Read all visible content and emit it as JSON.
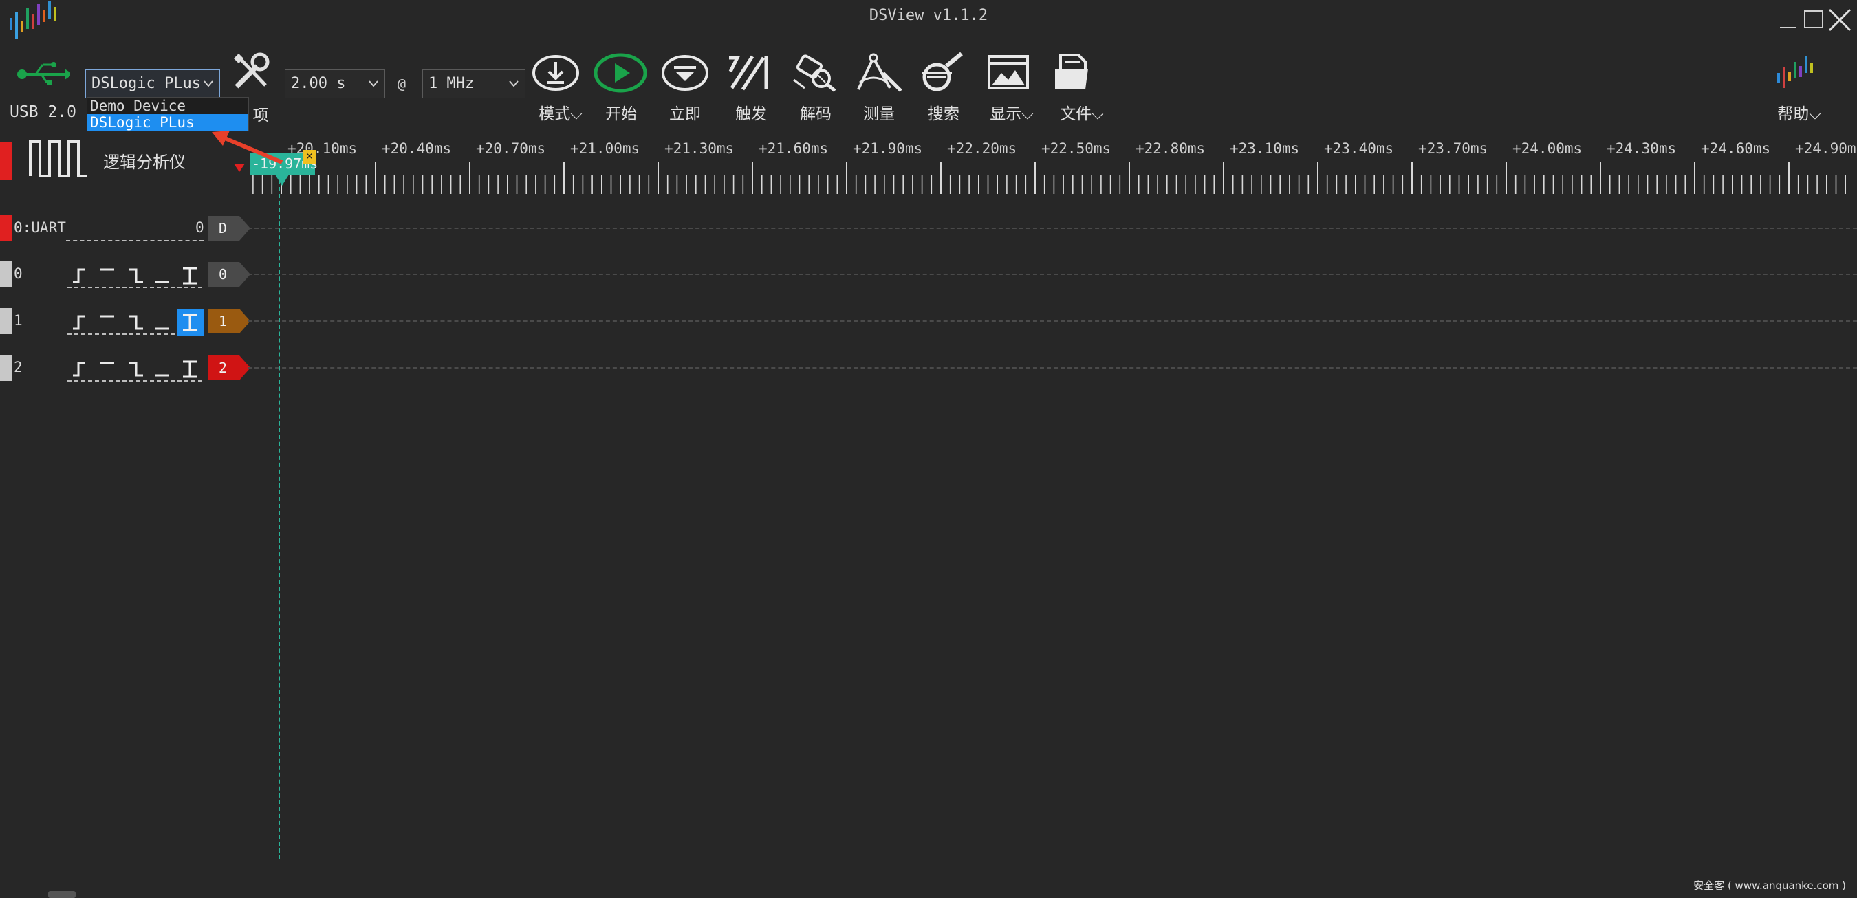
{
  "window": {
    "title": "DSView v1.1.2",
    "minimize_glyph": "_",
    "maximize_glyph": "□",
    "close_glyph": "✕"
  },
  "toolbar": {
    "usb_label": "USB 2.0",
    "device_selected": "DSLogic PLus",
    "device_options": [
      "Demo Device",
      "DSLogic PLus"
    ],
    "options_label": "项",
    "sample_time": "2.00 s",
    "at_symbol": "@",
    "sample_rate": "1 MHz",
    "buttons": {
      "mode": "模式",
      "start": "开始",
      "instant": "立即",
      "trigger": "触发",
      "decode": "解码",
      "measure": "测量",
      "search": "搜索",
      "display": "显示",
      "file": "文件",
      "help": "帮助"
    }
  },
  "ruler": {
    "cursor_label": "-19.97ms",
    "cursor_close": "✕",
    "ticks": [
      "+20.10ms",
      "+20.40ms",
      "+20.70ms",
      "+21.00ms",
      "+21.30ms",
      "+21.60ms",
      "+21.90ms",
      "+22.20ms",
      "+22.50ms",
      "+22.80ms",
      "+23.10ms",
      "+23.40ms",
      "+23.70ms",
      "+24.00ms",
      "+24.30ms",
      "+24.60ms",
      "+24.90m"
    ]
  },
  "header": {
    "mode_title": "逻辑分析仪"
  },
  "channels": [
    {
      "name": "0:UART",
      "value": "0",
      "tag": "D",
      "tag_color": "#4a4a4a",
      "bar_color": "#e02020",
      "kind": "decoder"
    },
    {
      "name": "0",
      "tag": "0",
      "tag_color": "#4a4a4a",
      "bar_color": "#c8c8c8",
      "kind": "logic"
    },
    {
      "name": "1",
      "tag": "1",
      "tag_color": "#9a5a10",
      "bar_color": "#c8c8c8",
      "kind": "logic",
      "selected_trigger": true
    },
    {
      "name": "2",
      "tag": "2",
      "tag_color": "#d01414",
      "bar_color": "#c8c8c8",
      "kind": "logic"
    }
  ],
  "colors": {
    "background": "#272727",
    "accent_green": "#1aa34a",
    "cursor_teal": "#2ab49a",
    "selection_blue": "#1e8ef0",
    "annotation_arrow": "#e8402a"
  },
  "watermark": "安全客 ( www.anquanke.com )"
}
